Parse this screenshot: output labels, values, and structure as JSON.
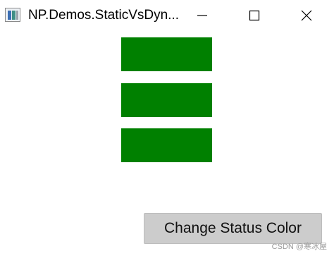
{
  "window": {
    "title": "NP.Demos.StaticVsDyn...",
    "icon": "wpf-app-icon"
  },
  "caption_buttons": {
    "minimize_icon": "minimize-icon",
    "maximize_icon": "maximize-icon",
    "close_icon": "close-icon"
  },
  "status_rectangles": {
    "color": "#008000",
    "count": 3
  },
  "main": {
    "change_button_label": "Change Status Color"
  },
  "watermark": {
    "text": "CSDN @寒冰屋"
  }
}
